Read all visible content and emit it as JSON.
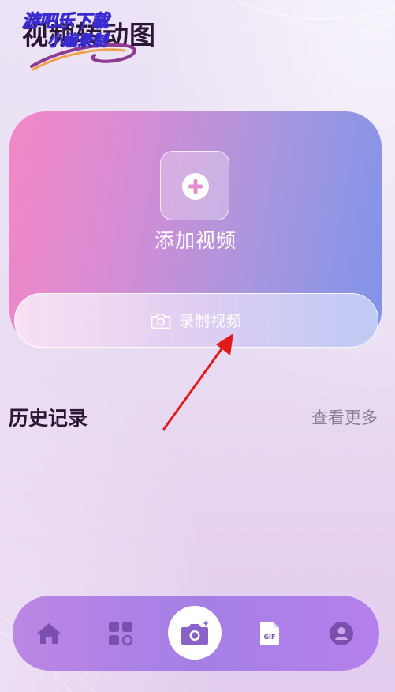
{
  "header": {
    "title": "视频转动图",
    "watermark_line1": "游吧乐下载",
    "watermark_line2": "小编录制"
  },
  "main_card": {
    "add_label": "添加视频",
    "record_label": "录制视频"
  },
  "history": {
    "title": "历史记录",
    "view_more": "查看更多"
  },
  "bottom_nav": {
    "items": [
      {
        "icon": "home-icon"
      },
      {
        "icon": "apps-icon"
      },
      {
        "icon": "camera-icon",
        "selected": true
      },
      {
        "icon": "gif-file-icon",
        "badge_text": "GIF"
      },
      {
        "icon": "profile-icon"
      }
    ]
  },
  "colors": {
    "accent_card_start": "#f387c5",
    "accent_card_end": "#7f93ea",
    "nav_background": "#a57fe6",
    "nav_icon": "#7a4fae",
    "annotation_arrow": "#e01b1b",
    "title_text": "#2c1638"
  }
}
